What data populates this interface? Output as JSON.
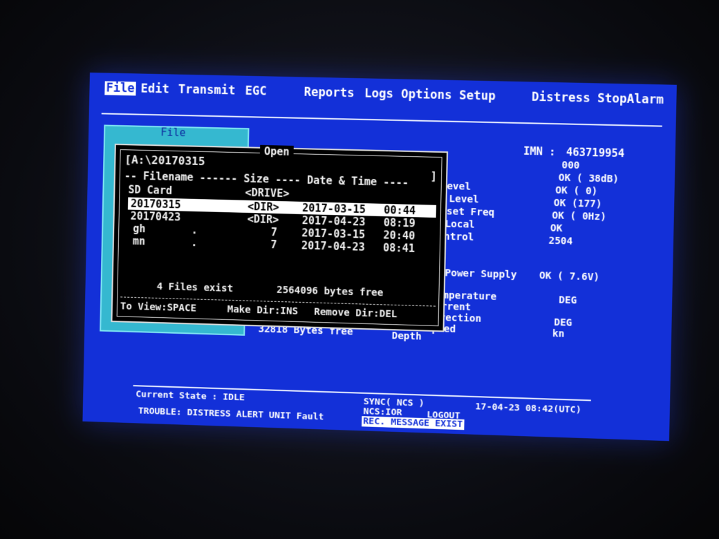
{
  "menu": {
    "file": "File",
    "edit": "Edit",
    "transmit": "Transmit",
    "egc": "EGC",
    "reports": "Reports",
    "logs": "Logs",
    "options": "Options",
    "setup": "Setup",
    "distress": "Distress",
    "stopalarm": "StopAlarm"
  },
  "status_panel": {
    "imn_label": "IMN :",
    "imn_value": "463719954",
    "line1_value": "000",
    "level_label": "Level",
    "level_value": "OK ( 38dB)",
    "c_level_label": "C Level",
    "c_level_value": "OK (  0)",
    "offset_label": "ffset Freq",
    "offset_value": "OK (177)",
    "local_label": "e Local",
    "local_value": "OK (      0Hz)",
    "control_label": "Control",
    "control_value": "OK",
    "control2_value": "2504",
    "power_label": "na Power Supply",
    "power_value": "OK ( 7.6V)",
    "temp_label": "Temperature",
    "temp_value": "DEG",
    "current_label": "Current",
    "direction_label": "Direction",
    "direction_value": "DEG",
    "speed_label": "Speed",
    "speed_value": "kn",
    "bytes_free": "32818 Bytes free",
    "depth_label": "Depth"
  },
  "file_window": {
    "title": "File"
  },
  "open_dialog": {
    "title": "Open",
    "path": "[A:\\20170315",
    "bracket": "]",
    "header": "-- Filename ------ Size ---- Date & Time ----",
    "rows": [
      {
        "name": "SD Card",
        "ext": "",
        "size": "<DRIVE>",
        "date": "",
        "time": ""
      },
      {
        "name": "20170315",
        "ext": "",
        "size": "<DIR>",
        "date": "2017-03-15",
        "time": "00:44"
      },
      {
        "name": "20170423",
        "ext": "",
        "size": "<DIR>",
        "date": "2017-04-23",
        "time": "08:19"
      },
      {
        "name": "gh",
        "ext": ".",
        "size": "7",
        "date": "2017-03-15",
        "time": "20:40"
      },
      {
        "name": "mn",
        "ext": ".",
        "size": "7",
        "date": "2017-04-23",
        "time": "08:41"
      }
    ],
    "files_exist": "4 Files exist",
    "bytes_free": "2564096 bytes free",
    "to_view": "To View:SPACE",
    "make_dir": "Make Dir:INS",
    "remove_dir": "Remove Dir:DEL"
  },
  "bottom_bar": {
    "current_state": "Current State :  IDLE",
    "sync": "SYNC( NCS )",
    "ncs": "NCS:IOR",
    "logout": "LOGOUT",
    "datetime": "17-04-23   08:42(UTC)",
    "trouble": "TROUBLE: DISTRESS ALERT UNIT Fault",
    "rec_message": "REC. MESSAGE EXIST"
  }
}
